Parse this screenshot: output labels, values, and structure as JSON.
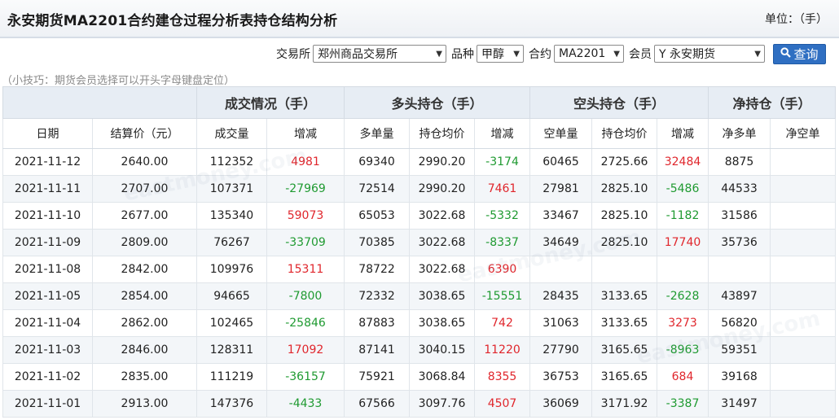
{
  "header": {
    "title": "永安期货MA2201合约建仓过程分析表持仓结构分析",
    "unit": "单位：（手）"
  },
  "filters": {
    "exchange_label": "交易所",
    "exchange_value": "郑州商品交易所",
    "variety_label": "品种",
    "variety_value": "甲醇",
    "contract_label": "合约",
    "contract_value": "MA2201",
    "member_label": "会员",
    "member_value": "Y 永安期货",
    "query_label": "查询",
    "query_icon": "search-icon"
  },
  "tip": "（小技巧：期货会员选择可以开头字母键盘定位）",
  "table": {
    "groups": [
      "成交情况（手）",
      "多头持仓（手）",
      "空头持仓（手）",
      "净持仓（手）"
    ],
    "columns": [
      "日期",
      "结算价（元）",
      "成交量",
      "增减",
      "多单量",
      "持仓均价",
      "增减",
      "空单量",
      "持仓均价",
      "增减",
      "净多单",
      "净空单"
    ],
    "rows": [
      [
        "2021-11-12",
        "2640.00",
        "112352",
        "4981",
        "69340",
        "2990.20",
        "-3174",
        "60465",
        "2725.66",
        "32484",
        "8875",
        ""
      ],
      [
        "2021-11-11",
        "2707.00",
        "107371",
        "-27969",
        "72514",
        "2990.20",
        "7461",
        "27981",
        "2825.10",
        "-5486",
        "44533",
        ""
      ],
      [
        "2021-11-10",
        "2677.00",
        "135340",
        "59073",
        "65053",
        "3022.68",
        "-5332",
        "33467",
        "2825.10",
        "-1182",
        "31586",
        ""
      ],
      [
        "2021-11-09",
        "2809.00",
        "76267",
        "-33709",
        "70385",
        "3022.68",
        "-8337",
        "34649",
        "2825.10",
        "17740",
        "35736",
        ""
      ],
      [
        "2021-11-08",
        "2842.00",
        "109976",
        "15311",
        "78722",
        "3022.68",
        "6390",
        "",
        "",
        "",
        "",
        ""
      ],
      [
        "2021-11-05",
        "2854.00",
        "94665",
        "-7800",
        "72332",
        "3038.65",
        "-15551",
        "28435",
        "3133.65",
        "-2628",
        "43897",
        ""
      ],
      [
        "2021-11-04",
        "2862.00",
        "102465",
        "-25846",
        "87883",
        "3038.65",
        "742",
        "31063",
        "3133.65",
        "3273",
        "56820",
        ""
      ],
      [
        "2021-11-03",
        "2846.00",
        "128311",
        "17092",
        "87141",
        "3040.15",
        "11220",
        "27790",
        "3165.65",
        "-8963",
        "59351",
        ""
      ],
      [
        "2021-11-02",
        "2835.00",
        "111219",
        "-36157",
        "75921",
        "3068.84",
        "8355",
        "36753",
        "3165.65",
        "684",
        "39168",
        ""
      ],
      [
        "2021-11-01",
        "2913.00",
        "147376",
        "-4433",
        "67566",
        "3097.76",
        "4507",
        "36069",
        "3171.92",
        "-3387",
        "31497",
        ""
      ]
    ]
  },
  "colors": {
    "increase": "#e0262c",
    "decrease": "#1f9a31",
    "header_bg": "#e7edf4",
    "button_bg": "#2f6fc2"
  },
  "watermark": "eastmoney.com"
}
